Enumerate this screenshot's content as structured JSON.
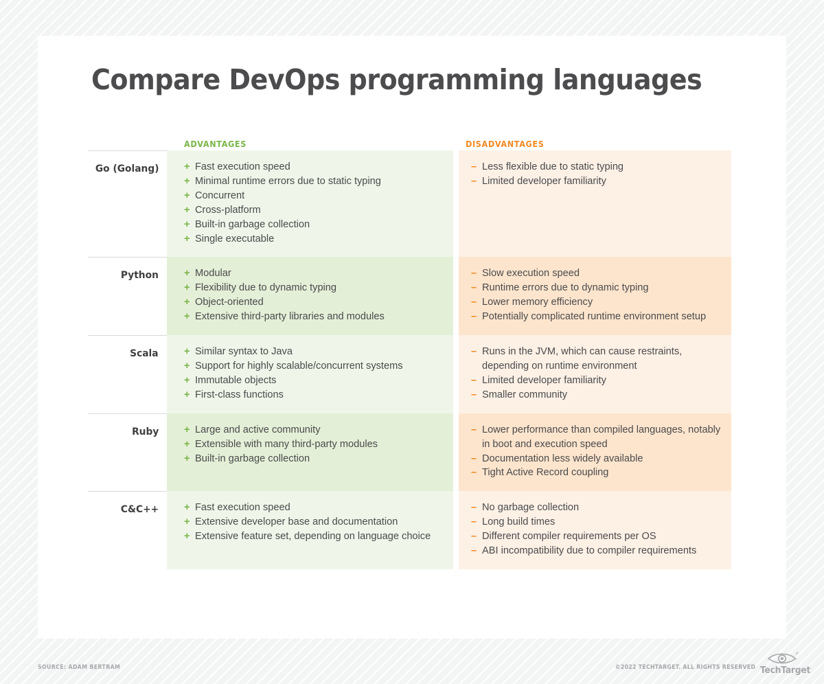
{
  "title": "Compare DevOps programming languages",
  "colors": {
    "advantages_accent": "#7ab648",
    "disadvantages_accent": "#f18a21",
    "title": "#4c4c4e",
    "adv_cell_light": "#eff6e9",
    "adv_cell_dark": "#e4efd7",
    "dis_cell_light": "#fdf1e6",
    "dis_cell_dark": "#fde5cd",
    "footer_text": "#a6a8ab"
  },
  "headers": {
    "advantages": "ADVANTAGES",
    "disadvantages": "DISADVANTAGES"
  },
  "markers": {
    "advantage": "+",
    "disadvantage": "–"
  },
  "rows": [
    {
      "language": "Go (Golang)",
      "advantages": [
        "Fast execution speed",
        "Minimal runtime errors due to static typing",
        "Concurrent",
        "Cross-platform",
        "Built-in garbage collection",
        "Single executable"
      ],
      "disadvantages": [
        "Less flexible due to static typing",
        "Limited developer familiarity"
      ]
    },
    {
      "language": "Python",
      "advantages": [
        "Modular",
        "Flexibility due to dynamic typing",
        "Object-oriented",
        "Extensive third-party libraries and modules"
      ],
      "disadvantages": [
        "Slow execution speed",
        "Runtime errors due to dynamic typing",
        "Lower memory efficiency",
        "Potentially complicated runtime environment setup"
      ]
    },
    {
      "language": "Scala",
      "advantages": [
        "Similar syntax to Java",
        "Support for highly scalable/concurrent systems",
        "Immutable objects",
        "First-class functions"
      ],
      "disadvantages": [
        "Runs in the JVM, which can cause restraints, depending on runtime environment",
        "Limited developer familiarity",
        "Smaller community"
      ]
    },
    {
      "language": "Ruby",
      "advantages": [
        "Large and active community",
        "Extensible with many third-party modules",
        "Built-in garbage collection"
      ],
      "disadvantages": [
        "Lower performance than compiled languages, notably in boot and execution speed",
        "Documentation less widely available",
        "Tight Active Record coupling"
      ]
    },
    {
      "language": "C&C++",
      "advantages": [
        "Fast execution speed",
        "Extensive developer base and documentation",
        "Extensive feature set, depending on language choice"
      ],
      "disadvantages": [
        "No garbage collection",
        "Long build times",
        "Different compiler requirements per OS",
        "ABI incompatibility due to compiler requirements"
      ]
    }
  ],
  "footer": {
    "source": "SOURCE: ADAM BERTRAM",
    "copyright": "©2022 TECHTARGET. ALL RIGHTS RESERVED",
    "logo_wordmark": "TechTarget"
  }
}
